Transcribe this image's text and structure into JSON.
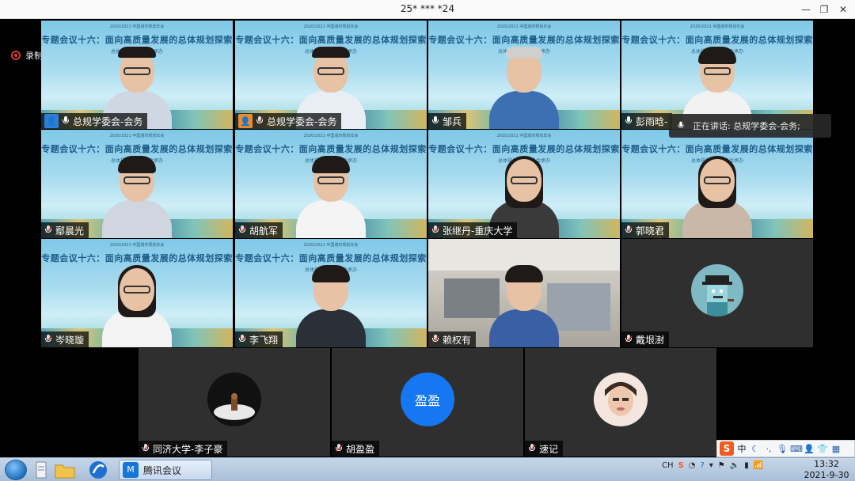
{
  "window": {
    "title": "25* *** *24",
    "buttons": {
      "minimize": "—",
      "restore": "❐",
      "close": "✕"
    }
  },
  "recording": {
    "label": "录制中"
  },
  "banner": {
    "title": "专题会议十六：面向高质量发展的总体规划探索",
    "subtitle": "总体规划学术委员会承办",
    "small": "2020/2021 中国城市规划年会"
  },
  "participants": [
    {
      "name": "总规学委会-会务",
      "badge": "host",
      "mic": "on",
      "type": "person"
    },
    {
      "name": "总规学委会-会务",
      "badge": "cohost",
      "mic": "off",
      "type": "person"
    },
    {
      "name": "邹兵",
      "mic": "on",
      "type": "person"
    },
    {
      "name": "彭雨晗-",
      "mic": "on",
      "type": "person"
    },
    {
      "name": "鄢晨光",
      "mic": "off",
      "type": "person"
    },
    {
      "name": "胡航军",
      "mic": "off",
      "type": "person"
    },
    {
      "name": "张继丹-重庆大学",
      "mic": "off",
      "type": "person"
    },
    {
      "name": "郭晓君",
      "mic": "off",
      "type": "person"
    },
    {
      "name": "岑晓璇",
      "mic": "off",
      "type": "person"
    },
    {
      "name": "李飞翔",
      "mic": "off",
      "type": "person"
    },
    {
      "name": "赖权有",
      "mic": "off",
      "type": "office"
    },
    {
      "name": "戴垠澍",
      "mic": "off",
      "type": "avatar"
    },
    {
      "name": "同济大学-李子豪",
      "mic": "off",
      "type": "avatar"
    },
    {
      "name": "胡盈盈",
      "mic": "off",
      "type": "initials",
      "initials": "盈盈"
    },
    {
      "name": "速记",
      "mic": "off",
      "type": "avatar"
    }
  ],
  "speaking_tooltip": "正在讲话: 总规学委会-会务;",
  "taskbar": {
    "app_label": "腾讯会议",
    "app_logo": "M",
    "ime": {
      "logo": "S",
      "mode": "中"
    },
    "tray_lang": "CH",
    "time": "13:32",
    "date": "2021-9-30"
  },
  "colors": {
    "banner_title": "#1e5d8a",
    "host_badge": "#2d7fd6",
    "cohost_badge": "#f08a2a",
    "initials_bg": "#1677f2"
  }
}
